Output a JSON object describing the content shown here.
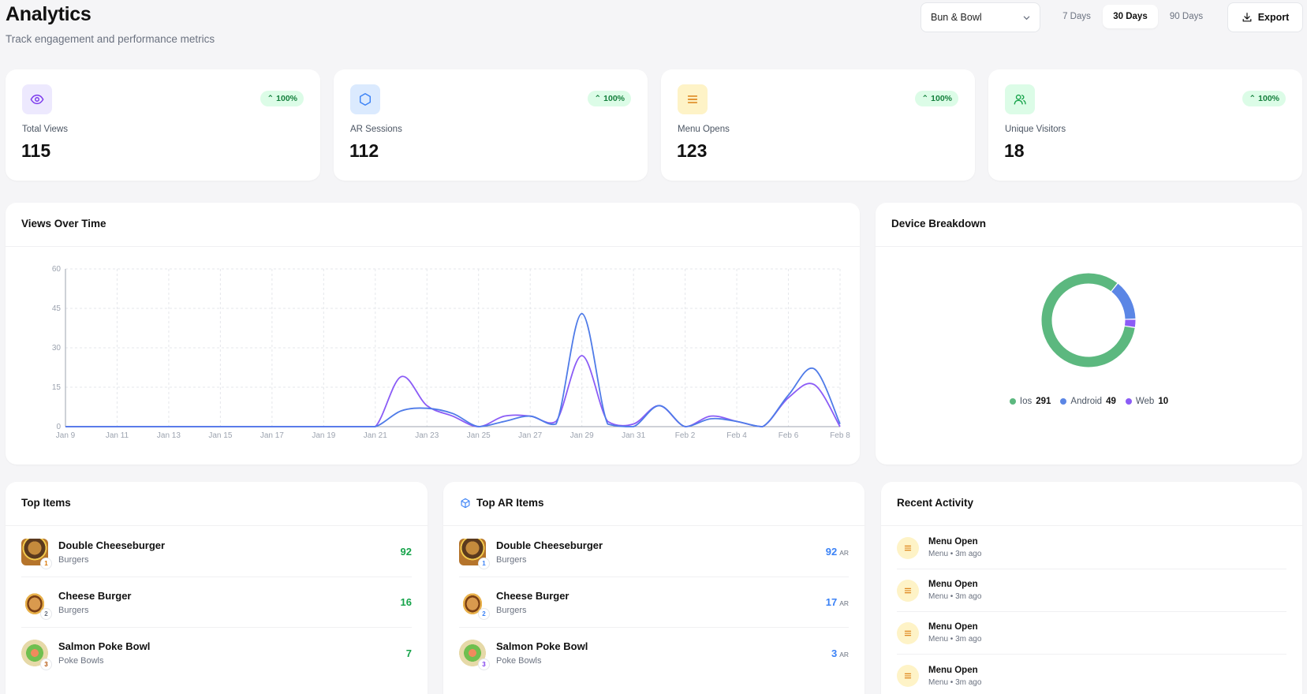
{
  "header": {
    "title": "Analytics",
    "subtitle": "Track engagement and performance metrics",
    "venue": "Bun & Bowl",
    "ranges": [
      "7 Days",
      "30 Days",
      "90 Days"
    ],
    "active_range": "30 Days",
    "export_label": "Export"
  },
  "stats": [
    {
      "label": "Total Views",
      "value": "115",
      "change": "100%",
      "icon": "eye-icon",
      "color": "#7c3aed",
      "bg": "#ede9fe"
    },
    {
      "label": "AR Sessions",
      "value": "112",
      "change": "100%",
      "icon": "cube-icon",
      "color": "#3b82f6",
      "bg": "#dbeafe"
    },
    {
      "label": "Menu Opens",
      "value": "123",
      "change": "100%",
      "icon": "menu-lines-icon",
      "color": "#d97706",
      "bg": "#fef3c7"
    },
    {
      "label": "Unique Visitors",
      "value": "18",
      "change": "100%",
      "icon": "users-icon",
      "color": "#16a34a",
      "bg": "#dcfce7"
    }
  ],
  "views_chart": {
    "title": "Views Over Time",
    "chart_data": {
      "type": "line",
      "x": [
        "Jan 9",
        "Jan 10",
        "Jan 11",
        "Jan 12",
        "Jan 13",
        "Jan 14",
        "Jan 15",
        "Jan 16",
        "Jan 17",
        "Jan 18",
        "Jan 19",
        "Jan 20",
        "Jan 21",
        "Jan 22",
        "Jan 23",
        "Jan 24",
        "Jan 25",
        "Jan 26",
        "Jan 27",
        "Jan 28",
        "Jan 29",
        "Jan 30",
        "Jan 31",
        "Feb 1",
        "Feb 2",
        "Feb 3",
        "Feb 4",
        "Feb 5",
        "Feb 6",
        "Feb 7",
        "Feb 8"
      ],
      "xticks": [
        "Jan 9",
        "Jan 11",
        "Jan 13",
        "Jan 15",
        "Jan 17",
        "Jan 19",
        "Jan 21",
        "Jan 23",
        "Jan 25",
        "Jan 27",
        "Jan 29",
        "Jan 31",
        "Feb 2",
        "Feb 4",
        "Feb 6",
        "Feb 8"
      ],
      "yticks": [
        0,
        15,
        30,
        45,
        60
      ],
      "ylim": [
        0,
        60
      ],
      "grid": true,
      "series": [
        {
          "color": "#8b5cf6",
          "values": [
            0,
            0,
            0,
            0,
            0,
            0,
            0,
            0,
            0,
            0,
            0,
            0,
            0,
            19,
            8,
            4,
            0,
            4,
            4,
            2,
            27,
            2,
            1,
            8,
            0,
            4,
            2,
            0,
            11,
            16,
            0
          ]
        },
        {
          "color": "#4f7be8",
          "values": [
            0,
            0,
            0,
            0,
            0,
            0,
            0,
            0,
            0,
            0,
            0,
            0,
            0,
            6,
            7,
            5,
            0,
            2,
            4,
            1,
            43,
            1,
            0,
            8,
            0,
            3,
            2,
            0,
            12,
            22,
            1
          ]
        }
      ]
    }
  },
  "device": {
    "title": "Device Breakdown",
    "chart_data": {
      "type": "pie",
      "series": [
        {
          "name": "Ios",
          "value": 291,
          "color": "#5cb87f"
        },
        {
          "name": "Android",
          "value": 49,
          "color": "#5b86e5"
        },
        {
          "name": "Web",
          "value": 10,
          "color": "#8b5cf6"
        }
      ]
    }
  },
  "top_items": {
    "title": "Top Items",
    "items": [
      {
        "rank": "1",
        "name": "Double Cheeseburger",
        "category": "Burgers",
        "count": "92",
        "thumb": "burger-icon"
      },
      {
        "rank": "2",
        "name": "Cheese Burger",
        "category": "Burgers",
        "count": "16",
        "thumb": "burger-icon"
      },
      {
        "rank": "3",
        "name": "Salmon Poke Bowl",
        "category": "Poke Bowls",
        "count": "7",
        "thumb": "bowl-icon"
      }
    ]
  },
  "top_ar_items": {
    "title": "Top AR Items",
    "suffix": "AR",
    "items": [
      {
        "rank": "1",
        "name": "Double Cheeseburger",
        "category": "Burgers",
        "count": "92",
        "thumb": "burger-icon"
      },
      {
        "rank": "2",
        "name": "Cheese Burger",
        "category": "Burgers",
        "count": "17",
        "thumb": "burger-icon"
      },
      {
        "rank": "3",
        "name": "Salmon Poke Bowl",
        "category": "Poke Bowls",
        "count": "3",
        "thumb": "bowl-icon"
      }
    ]
  },
  "recent_activity": {
    "title": "Recent Activity",
    "items": [
      {
        "title": "Menu Open",
        "sub": "Menu • 3m ago"
      },
      {
        "title": "Menu Open",
        "sub": "Menu • 3m ago"
      },
      {
        "title": "Menu Open",
        "sub": "Menu • 3m ago"
      },
      {
        "title": "Menu Open",
        "sub": "Menu • 3m ago"
      }
    ]
  },
  "colors": {
    "accent_green": "#16a34a",
    "accent_blue": "#3b82f6",
    "accent_purple": "#7c3aed"
  }
}
